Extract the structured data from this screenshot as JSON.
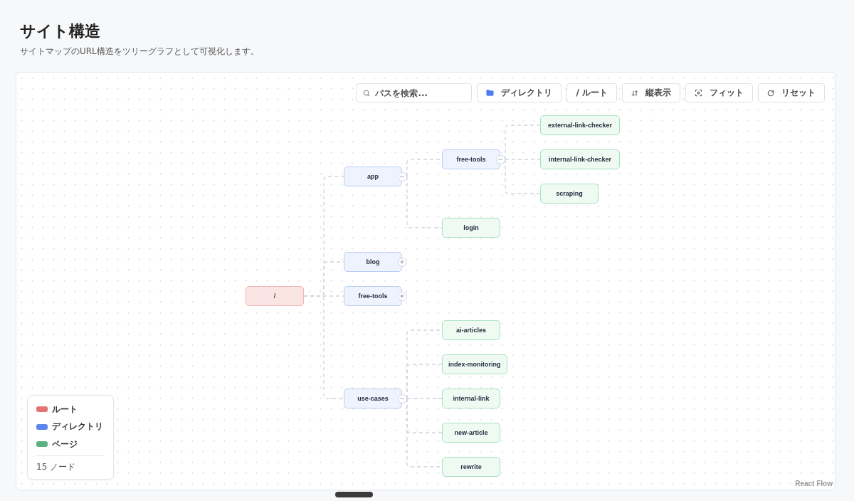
{
  "header": {
    "title": "サイト構造",
    "subtitle": "サイトマップのURL構造をツリーグラフとして可視化します。"
  },
  "toolbar": {
    "search": {
      "placeholder": "パスを検索..."
    },
    "buttons": [
      {
        "kind": "directory",
        "label": "ディレクトリ"
      },
      {
        "kind": "root",
        "label": "/ ルート"
      },
      {
        "kind": "orientation",
        "label": "縦表示"
      },
      {
        "kind": "fit",
        "label": "フィット"
      },
      {
        "kind": "reset",
        "label": "リセット"
      }
    ]
  },
  "tree": {
    "label": "/",
    "kind": "root",
    "children": [
      {
        "label": "app",
        "kind": "directory",
        "expanded": true,
        "children": [
          {
            "label": "free-tools",
            "kind": "directory",
            "expanded": true,
            "children": [
              {
                "label": "external-link-checker",
                "kind": "page"
              },
              {
                "label": "internal-link-checker",
                "kind": "page"
              },
              {
                "label": "scraping",
                "kind": "page"
              }
            ]
          },
          {
            "label": "login",
            "kind": "page"
          }
        ]
      },
      {
        "label": "blog",
        "kind": "directory",
        "expanded": false
      },
      {
        "label": "free-tools",
        "kind": "directory",
        "expanded": false
      },
      {
        "label": "use-cases",
        "kind": "directory",
        "expanded": true,
        "children": [
          {
            "label": "ai-articles",
            "kind": "page"
          },
          {
            "label": "index-monitoring",
            "kind": "page"
          },
          {
            "label": "internal-link",
            "kind": "page"
          },
          {
            "label": "new-article",
            "kind": "page"
          },
          {
            "label": "rewrite",
            "kind": "page"
          }
        ]
      }
    ]
  },
  "legend": {
    "items": [
      {
        "label": "ルート",
        "color": "#e57373"
      },
      {
        "label": "ディレクトリ",
        "color": "#5b86ee"
      },
      {
        "label": "ページ",
        "color": "#5cb27f"
      }
    ],
    "count": "15 ノード"
  },
  "attribution": "React Flow"
}
